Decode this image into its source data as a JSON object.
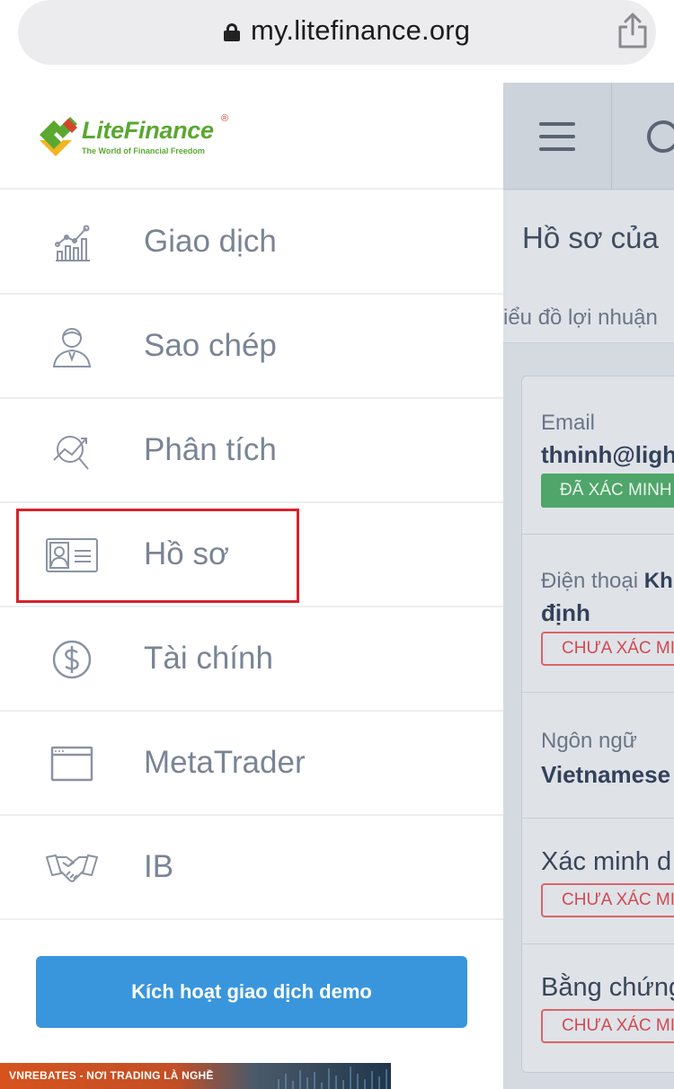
{
  "browser": {
    "url": "my.litefinance.org"
  },
  "logo": {
    "name": "LiteFinance",
    "registered": "®",
    "tagline": "The World of Financial Freedom"
  },
  "nav": {
    "items": [
      {
        "label": "Giao dịch",
        "icon": "trading-chart-icon"
      },
      {
        "label": "Sao chép",
        "icon": "trader-person-icon"
      },
      {
        "label": "Phân tích",
        "icon": "analysis-magnifier-icon"
      },
      {
        "label": "Hồ sơ",
        "icon": "profile-card-icon",
        "highlighted": true
      },
      {
        "label": "Tài chính",
        "icon": "dollar-circle-icon"
      },
      {
        "label": "MetaTrader",
        "icon": "window-icon"
      },
      {
        "label": "IB",
        "icon": "handshake-icon"
      }
    ],
    "demo_button": "Kích hoạt giao dịch demo"
  },
  "page": {
    "title": "Hồ sơ của",
    "tab_text": "iểu đồ lợi nhuận",
    "email_label": "Email",
    "email_value": "thninh@ligh",
    "email_badge": "ĐÃ XÁC MINH",
    "phone_label": "Điện thoại",
    "phone_label_bold": "Kh",
    "phone_value": "định",
    "phone_badge": "CHƯA XÁC MI",
    "language_label": "Ngôn ngữ",
    "language_value": "Vietnamese",
    "verify_label": "Xác minh d",
    "verify_badge": "CHƯA XÁC MI",
    "proof_label": "Bằng chứng",
    "proof_badge": "CHƯA XÁC MI"
  },
  "watermark": {
    "text": "VNREBATES - NƠI TRADING LÀ NGHỀ"
  },
  "colors": {
    "accent_blue": "#3a96dc",
    "highlight_red": "#d8222a",
    "verified_green": "#4fa56a",
    "unverified_red": "#d04a52",
    "logo_green": "#5aa830"
  }
}
